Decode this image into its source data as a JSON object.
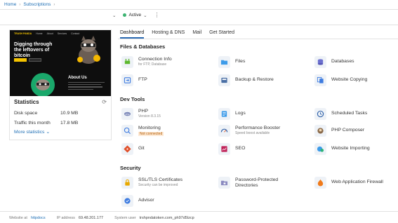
{
  "breadcrumb": {
    "home": "Home",
    "subscriptions": "Subscriptions"
  },
  "domain": {
    "status": "Active"
  },
  "preview": {
    "logo": "TRASH PANDA",
    "nav": [
      "Home",
      "About",
      "Services",
      "Contact"
    ],
    "headline": "Digging through the leftovers of bitcoin",
    "about": "About Us"
  },
  "stats": {
    "title": "Statistics",
    "disk_label": "Disk space",
    "disk_value": "10.9 MB",
    "traffic_label": "Traffic this month",
    "traffic_value": "17.8 MB",
    "more_label": "More statistics"
  },
  "tabs": [
    "Dashboard",
    "Hosting & DNS",
    "Mail",
    "Get Started"
  ],
  "sections": {
    "files": "Files & Databases",
    "dev": "Dev Tools",
    "security": "Security"
  },
  "items": {
    "connection": {
      "label": "Connection Info",
      "sub": "for FTP, Database"
    },
    "files": {
      "label": "Files"
    },
    "databases": {
      "label": "Databases"
    },
    "ftp": {
      "label": "FTP"
    },
    "backup": {
      "label": "Backup & Restore"
    },
    "copying": {
      "label": "Website Copying"
    },
    "php": {
      "label": "PHP",
      "sub": "Version 8.3.15"
    },
    "logs": {
      "label": "Logs"
    },
    "tasks": {
      "label": "Scheduled Tasks"
    },
    "monitoring": {
      "label": "Monitoring",
      "sub": "Not connected"
    },
    "booster": {
      "label": "Performance Booster",
      "sub": "Speed boost available"
    },
    "composer": {
      "label": "PHP Composer"
    },
    "git": {
      "label": "Git"
    },
    "seo": {
      "label": "SEO"
    },
    "importing": {
      "label": "Website Importing"
    },
    "ssl": {
      "label": "SSL/TLS Certificates",
      "sub": "Security can be improved"
    },
    "password": {
      "label": "Password-Protected Directories"
    },
    "waf": {
      "label": "Web Application Firewall"
    },
    "advisor": {
      "label": "Advisor"
    }
  },
  "footer": {
    "website_label": "Website at",
    "website_link": "httpdocs",
    "ip_label": "IP address",
    "ip_value": "69.48.201.177",
    "user_label": "System user",
    "user_value": "trshpndatoken.com_ph97d5lzcp"
  },
  "colors": {
    "accent": "#2a6ab3",
    "active": "#3cb371",
    "warning": "#b25a00"
  }
}
